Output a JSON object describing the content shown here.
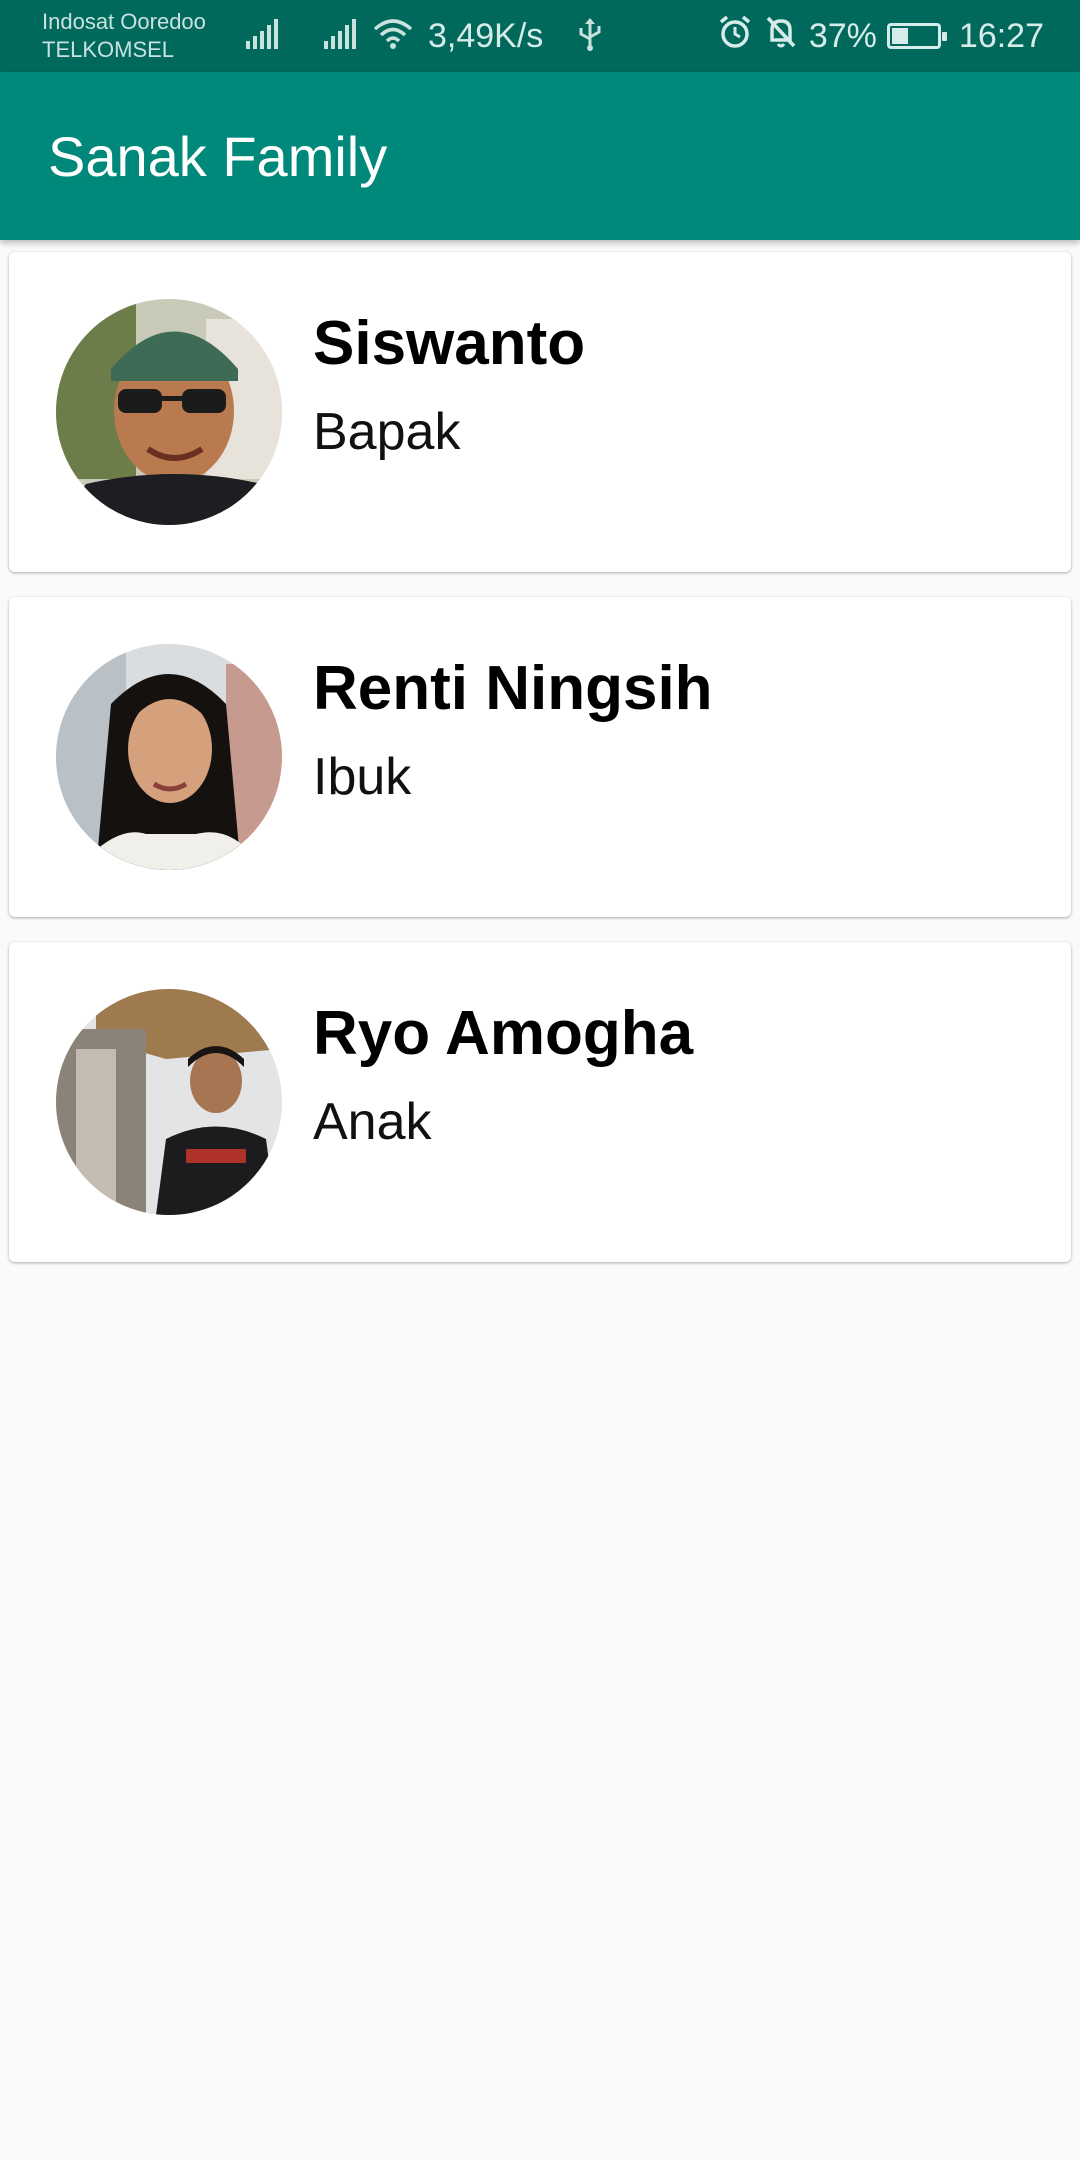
{
  "status_bar": {
    "carrier_1": "Indosat Ooredoo",
    "carrier_2": "TELKOMSEL",
    "network_speed": "3,49K/s",
    "battery_percent": "37%",
    "battery_level": 0.37,
    "time": "16:27",
    "icons": [
      "signal-icon",
      "signal-icon",
      "wifi-icon",
      "usb-icon",
      "alarm-icon",
      "notifications-off-icon",
      "battery-charging-icon"
    ]
  },
  "app_bar": {
    "title": "Sanak Family"
  },
  "family": [
    {
      "name": "Siswanto",
      "role": "Bapak"
    },
    {
      "name": "Renti Ningsih",
      "role": "Ibuk"
    },
    {
      "name": "Ryo Amogha",
      "role": "Anak"
    }
  ],
  "colors": {
    "status_bar": "#00695c",
    "app_bar": "#00897b",
    "background": "#fafafa",
    "card": "#ffffff"
  }
}
